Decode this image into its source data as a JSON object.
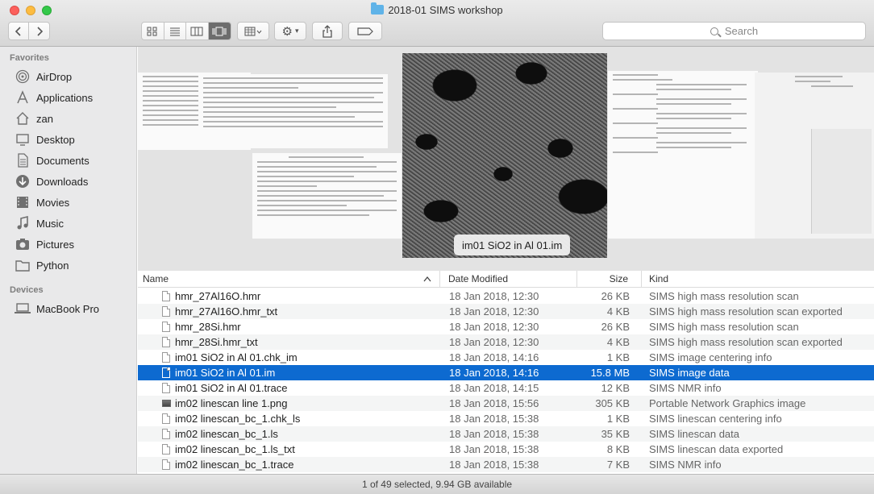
{
  "window": {
    "title": "2018-01 SIMS workshop"
  },
  "toolbar": {
    "search_placeholder": "Search",
    "back_icon": "chevron-left-icon",
    "forward_icon": "chevron-right-icon",
    "view_modes": [
      "icon-view-icon",
      "list-view-icon",
      "column-view-icon",
      "cover-flow-view-icon"
    ],
    "active_view": "cover-flow"
  },
  "sidebar": {
    "favorites_header": "Favorites",
    "favorites": [
      {
        "label": "AirDrop",
        "icon": "airdrop-icon"
      },
      {
        "label": "Applications",
        "icon": "applications-icon"
      },
      {
        "label": "zan",
        "icon": "home-icon"
      },
      {
        "label": "Desktop",
        "icon": "desktop-icon"
      },
      {
        "label": "Documents",
        "icon": "documents-icon"
      },
      {
        "label": "Downloads",
        "icon": "downloads-icon"
      },
      {
        "label": "Movies",
        "icon": "movies-icon"
      },
      {
        "label": "Music",
        "icon": "music-icon"
      },
      {
        "label": "Pictures",
        "icon": "pictures-icon"
      },
      {
        "label": "Python",
        "icon": "folder-icon"
      }
    ],
    "devices_header": "Devices",
    "devices": [
      {
        "label": "MacBook Pro",
        "icon": "laptop-icon"
      }
    ]
  },
  "preview": {
    "caption": "im01 SiO2 in Al 01.im"
  },
  "list": {
    "headers": {
      "name": "Name",
      "date": "Date Modified",
      "size": "Size",
      "kind": "Kind"
    },
    "rows": [
      {
        "name": "hmr_27Al16O.hmr",
        "date": "18 Jan 2018, 12:30",
        "size": "26 KB",
        "kind": "SIMS high mass resolution scan",
        "icon": "document-icon"
      },
      {
        "name": "hmr_27Al16O.hmr_txt",
        "date": "18 Jan 2018, 12:30",
        "size": "4 KB",
        "kind": "SIMS high mass resolution scan exported",
        "icon": "document-icon"
      },
      {
        "name": "hmr_28Si.hmr",
        "date": "18 Jan 2018, 12:30",
        "size": "26 KB",
        "kind": "SIMS high mass resolution scan",
        "icon": "document-icon"
      },
      {
        "name": "hmr_28Si.hmr_txt",
        "date": "18 Jan 2018, 12:30",
        "size": "4 KB",
        "kind": "SIMS high mass resolution scan exported",
        "icon": "document-icon"
      },
      {
        "name": "im01 SiO2 in Al 01.chk_im",
        "date": "18 Jan 2018, 14:16",
        "size": "1 KB",
        "kind": "SIMS image centering info",
        "icon": "document-icon"
      },
      {
        "name": "im01 SiO2 in Al 01.im",
        "date": "18 Jan 2018, 14:16",
        "size": "15.8 MB",
        "kind": "SIMS image data",
        "icon": "document-icon",
        "selected": true
      },
      {
        "name": "im01 SiO2 in Al 01.trace",
        "date": "18 Jan 2018, 14:15",
        "size": "12 KB",
        "kind": "SIMS NMR info",
        "icon": "document-icon"
      },
      {
        "name": "im02 linescan line 1.png",
        "date": "18 Jan 2018, 15:56",
        "size": "305 KB",
        "kind": "Portable Network Graphics image",
        "icon": "png-thumbnail-icon"
      },
      {
        "name": "im02 linescan_bc_1.chk_ls",
        "date": "18 Jan 2018, 15:38",
        "size": "1 KB",
        "kind": "SIMS linescan centering info",
        "icon": "document-icon"
      },
      {
        "name": "im02 linescan_bc_1.ls",
        "date": "18 Jan 2018, 15:38",
        "size": "35 KB",
        "kind": "SIMS linescan data",
        "icon": "document-icon"
      },
      {
        "name": "im02 linescan_bc_1.ls_txt",
        "date": "18 Jan 2018, 15:38",
        "size": "8 KB",
        "kind": "SIMS linescan data exported",
        "icon": "document-icon"
      },
      {
        "name": "im02 linescan_bc_1.trace",
        "date": "18 Jan 2018, 15:38",
        "size": "7 KB",
        "kind": "SIMS NMR info",
        "icon": "document-icon"
      }
    ]
  },
  "status": "1 of 49 selected, 9.94 GB available",
  "colors": {
    "selection": "#0d6ad0",
    "folder": "#5fb3e8"
  }
}
